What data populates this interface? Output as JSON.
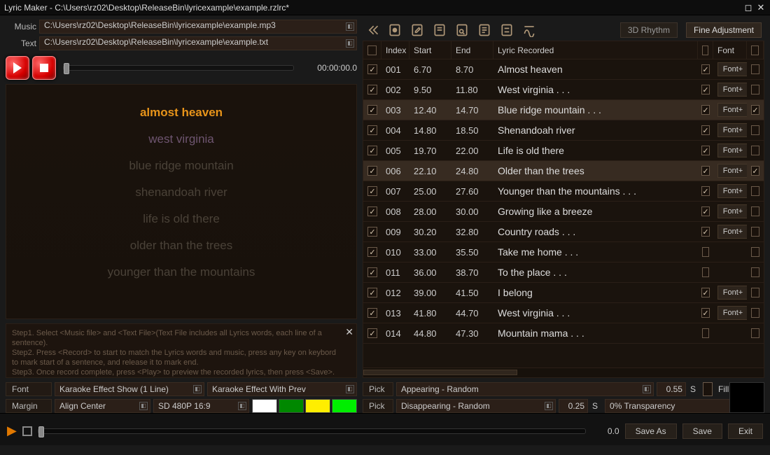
{
  "title": "Lyric Maker -   C:\\Users\\rz02\\Desktop\\ReleaseBin\\lyricexample\\example.rzlrc*",
  "paths": {
    "music_label": "Music",
    "music": "C:\\Users\\rz02\\Desktop\\ReleaseBin\\lyricexample\\example.mp3",
    "text_label": "Text",
    "text": "C:\\Users\\rz02\\Desktop\\ReleaseBin\\lyricexample\\example.txt"
  },
  "player": {
    "time": "00:00:00.0"
  },
  "preview_lines": [
    {
      "text": "almost heaven",
      "cls": "current"
    },
    {
      "text": "west virginia",
      "cls": "next"
    },
    {
      "text": "blue ridge mountain",
      "cls": ""
    },
    {
      "text": "shenandoah river",
      "cls": ""
    },
    {
      "text": "life is old there",
      "cls": ""
    },
    {
      "text": "older than the trees",
      "cls": ""
    },
    {
      "text": "younger than the mountains",
      "cls": ""
    }
  ],
  "help": {
    "s1": "Step1. Select <Music file> and <Text File>(Text File includes all Lyrics words, each line of a sentence).",
    "s2": "Step2. Press <Record> to start to match the Lyrics words and music, press any key on keybord to mark start of a sentence, and release it to mark end.",
    "s3": "Step3. Once record complete, press <Play> to preview the recorded lyrics, then press <Save>."
  },
  "leftbottom": {
    "font_label": "Font",
    "effect1": "Karaoke Effect Show (1 Line)",
    "effect2": "Karaoke Effect With Prev",
    "margin_label": "Margin",
    "align": "Align Center",
    "res": "SD 480P 16:9",
    "swatches": [
      "#ffffff",
      "#008800",
      "#ffee00",
      "#00ee00"
    ]
  },
  "toolbar": {
    "btn_3d": "3D Rhythm",
    "btn_fine": "Fine Adjustment"
  },
  "grid": {
    "headers": {
      "index": "Index",
      "start": "Start",
      "end": "End",
      "lyric": "Lyric Recorded",
      "font": "Font"
    },
    "rows": [
      {
        "chk": true,
        "idx": "001",
        "start": "6.70",
        "end": "8.70",
        "lyric": "Almost heaven",
        "fchk": true,
        "font": true,
        "echk": false,
        "hl": false
      },
      {
        "chk": true,
        "idx": "002",
        "start": "9.50",
        "end": "11.80",
        "lyric": "West virginia . . .",
        "fchk": true,
        "font": true,
        "echk": false,
        "hl": false
      },
      {
        "chk": true,
        "idx": "003",
        "start": "12.40",
        "end": "14.70",
        "lyric": "Blue ridge mountain . . .",
        "fchk": true,
        "font": true,
        "echk": true,
        "hl": true
      },
      {
        "chk": true,
        "idx": "004",
        "start": "14.80",
        "end": "18.50",
        "lyric": "Shenandoah river",
        "fchk": true,
        "font": true,
        "echk": false,
        "hl": false
      },
      {
        "chk": true,
        "idx": "005",
        "start": "19.70",
        "end": "22.00",
        "lyric": "Life is old there",
        "fchk": true,
        "font": true,
        "echk": false,
        "hl": false
      },
      {
        "chk": true,
        "idx": "006",
        "start": "22.10",
        "end": "24.80",
        "lyric": "Older than the trees",
        "fchk": true,
        "font": true,
        "echk": true,
        "hl": true
      },
      {
        "chk": true,
        "idx": "007",
        "start": "25.00",
        "end": "27.60",
        "lyric": "Younger than the mountains . . .",
        "fchk": true,
        "font": true,
        "echk": false,
        "hl": false
      },
      {
        "chk": true,
        "idx": "008",
        "start": "28.00",
        "end": "30.00",
        "lyric": "Growing like a breeze",
        "fchk": true,
        "font": true,
        "echk": false,
        "hl": false
      },
      {
        "chk": true,
        "idx": "009",
        "start": "30.20",
        "end": "32.80",
        "lyric": "Country roads . . .",
        "fchk": true,
        "font": true,
        "echk": false,
        "hl": false
      },
      {
        "chk": true,
        "idx": "010",
        "start": "33.00",
        "end": "35.50",
        "lyric": "Take me home . . .",
        "fchk": false,
        "font": false,
        "echk": false,
        "hl": false
      },
      {
        "chk": true,
        "idx": "011",
        "start": "36.00",
        "end": "38.70",
        "lyric": "To the place . . .",
        "fchk": false,
        "font": false,
        "echk": false,
        "hl": false
      },
      {
        "chk": true,
        "idx": "012",
        "start": "39.00",
        "end": "41.50",
        "lyric": "I belong",
        "fchk": true,
        "font": true,
        "echk": false,
        "hl": false
      },
      {
        "chk": true,
        "idx": "013",
        "start": "41.80",
        "end": "44.70",
        "lyric": "West virginia . . .",
        "fchk": true,
        "font": true,
        "echk": false,
        "hl": false
      },
      {
        "chk": true,
        "idx": "014",
        "start": "44.80",
        "end": "47.30",
        "lyric": "Mountain mama . . .",
        "fchk": false,
        "font": false,
        "echk": false,
        "hl": false
      }
    ],
    "font_btn": "Font+"
  },
  "rightbottom": {
    "pick_label": "Pick",
    "appear": "Appearing - Random",
    "appear_v": "0.55",
    "disappear": "Disappearing - Random",
    "disappear_v": "0.25",
    "unit": "S",
    "fill_label": "Fill Duration",
    "transp": "0% Transparency"
  },
  "footer": {
    "time": "0.0",
    "save_as": "Save As",
    "save": "Save",
    "exit": "Exit"
  }
}
